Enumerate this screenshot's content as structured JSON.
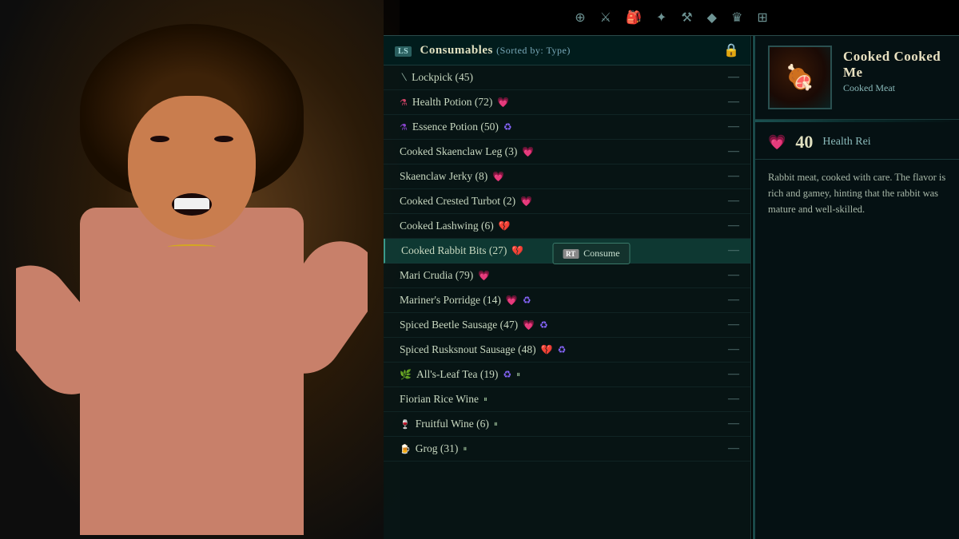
{
  "background": {
    "color": "#0a0a0a"
  },
  "iconBar": {
    "icons": [
      {
        "name": "character-icon",
        "symbol": "⊕",
        "active": false
      },
      {
        "name": "sword-icon",
        "symbol": "⚔",
        "active": false
      },
      {
        "name": "inventory-icon",
        "symbol": "🎒",
        "active": true
      },
      {
        "name": "skills-icon",
        "symbol": "✦",
        "active": false
      },
      {
        "name": "anvil-icon",
        "symbol": "⚒",
        "active": false
      },
      {
        "name": "gem-icon",
        "symbol": "◆",
        "active": false
      },
      {
        "name": "crown-icon",
        "symbol": "♛",
        "active": false
      },
      {
        "name": "map-icon",
        "symbol": "⊞",
        "active": false
      }
    ]
  },
  "inventory": {
    "badge": "LS",
    "title": "Consumables",
    "sortedBy": "(Sorted by: Type)",
    "lockLabel": "🔒",
    "items": [
      {
        "id": 1,
        "name": "Lockpick",
        "count": 45,
        "icons": [],
        "selected": false
      },
      {
        "id": 2,
        "name": "Health Potion",
        "count": 72,
        "icons": [
          "heart"
        ],
        "selected": false
      },
      {
        "id": 3,
        "name": "Essence Potion",
        "count": 50,
        "icons": [
          "essence"
        ],
        "selected": false
      },
      {
        "id": 4,
        "name": "Cooked Skaenclaw Leg",
        "count": 3,
        "icons": [
          "heart"
        ],
        "selected": false
      },
      {
        "id": 5,
        "name": "Skaenclaw Jerky",
        "count": 8,
        "icons": [
          "heart"
        ],
        "selected": false
      },
      {
        "id": 6,
        "name": "Cooked Crested Turbot",
        "count": 2,
        "icons": [
          "heart"
        ],
        "selected": false
      },
      {
        "id": 7,
        "name": "Cooked Lashwing",
        "count": 6,
        "icons": [
          "brokenheart"
        ],
        "selected": false
      },
      {
        "id": 8,
        "name": "Cooked Rabbit Bits",
        "count": 27,
        "icons": [
          "brokenheart"
        ],
        "selected": true,
        "tooltip": true
      },
      {
        "id": 9,
        "name": "Mari Crudia",
        "count": 79,
        "icons": [
          "heart"
        ],
        "selected": false
      },
      {
        "id": 10,
        "name": "Mariner's Porridge",
        "count": 14,
        "icons": [
          "heart",
          "essence"
        ],
        "selected": false
      },
      {
        "id": 11,
        "name": "Spiced Beetle Sausage",
        "count": 47,
        "icons": [
          "heart",
          "essence"
        ],
        "selected": false
      },
      {
        "id": 12,
        "name": "Spiced Rusksnout Sausage",
        "count": 48,
        "icons": [
          "brokenheart",
          "essence"
        ],
        "selected": false
      },
      {
        "id": 13,
        "name": "All's-Leaf Tea",
        "count": 19,
        "icons": [
          "essence",
          "food"
        ],
        "selected": false
      },
      {
        "id": 14,
        "name": "Fiorian Rice Wine",
        "count": null,
        "icons": [
          "food"
        ],
        "selected": false
      },
      {
        "id": 15,
        "name": "Fruitful Wine",
        "count": 6,
        "icons": [
          "food"
        ],
        "selected": false
      },
      {
        "id": 16,
        "name": "Grog",
        "count": 31,
        "icons": [
          "food"
        ],
        "selected": false
      }
    ],
    "tooltip": {
      "rtLabel": "RT",
      "consumeLabel": "Consume"
    }
  },
  "detail": {
    "itemName": "Cooked Cooked Me",
    "itemSubtitle": "Cooked Meat",
    "healthRegen": {
      "label": "Health Rei",
      "value": 40,
      "iconLabel": "Health Regeneration"
    },
    "description": "Rabbit meat, cooked with care. The flavor is rich and gamey, hinting that the rabbit was mature and well-skilled.",
    "thumbnailEmoji": "🍖"
  }
}
